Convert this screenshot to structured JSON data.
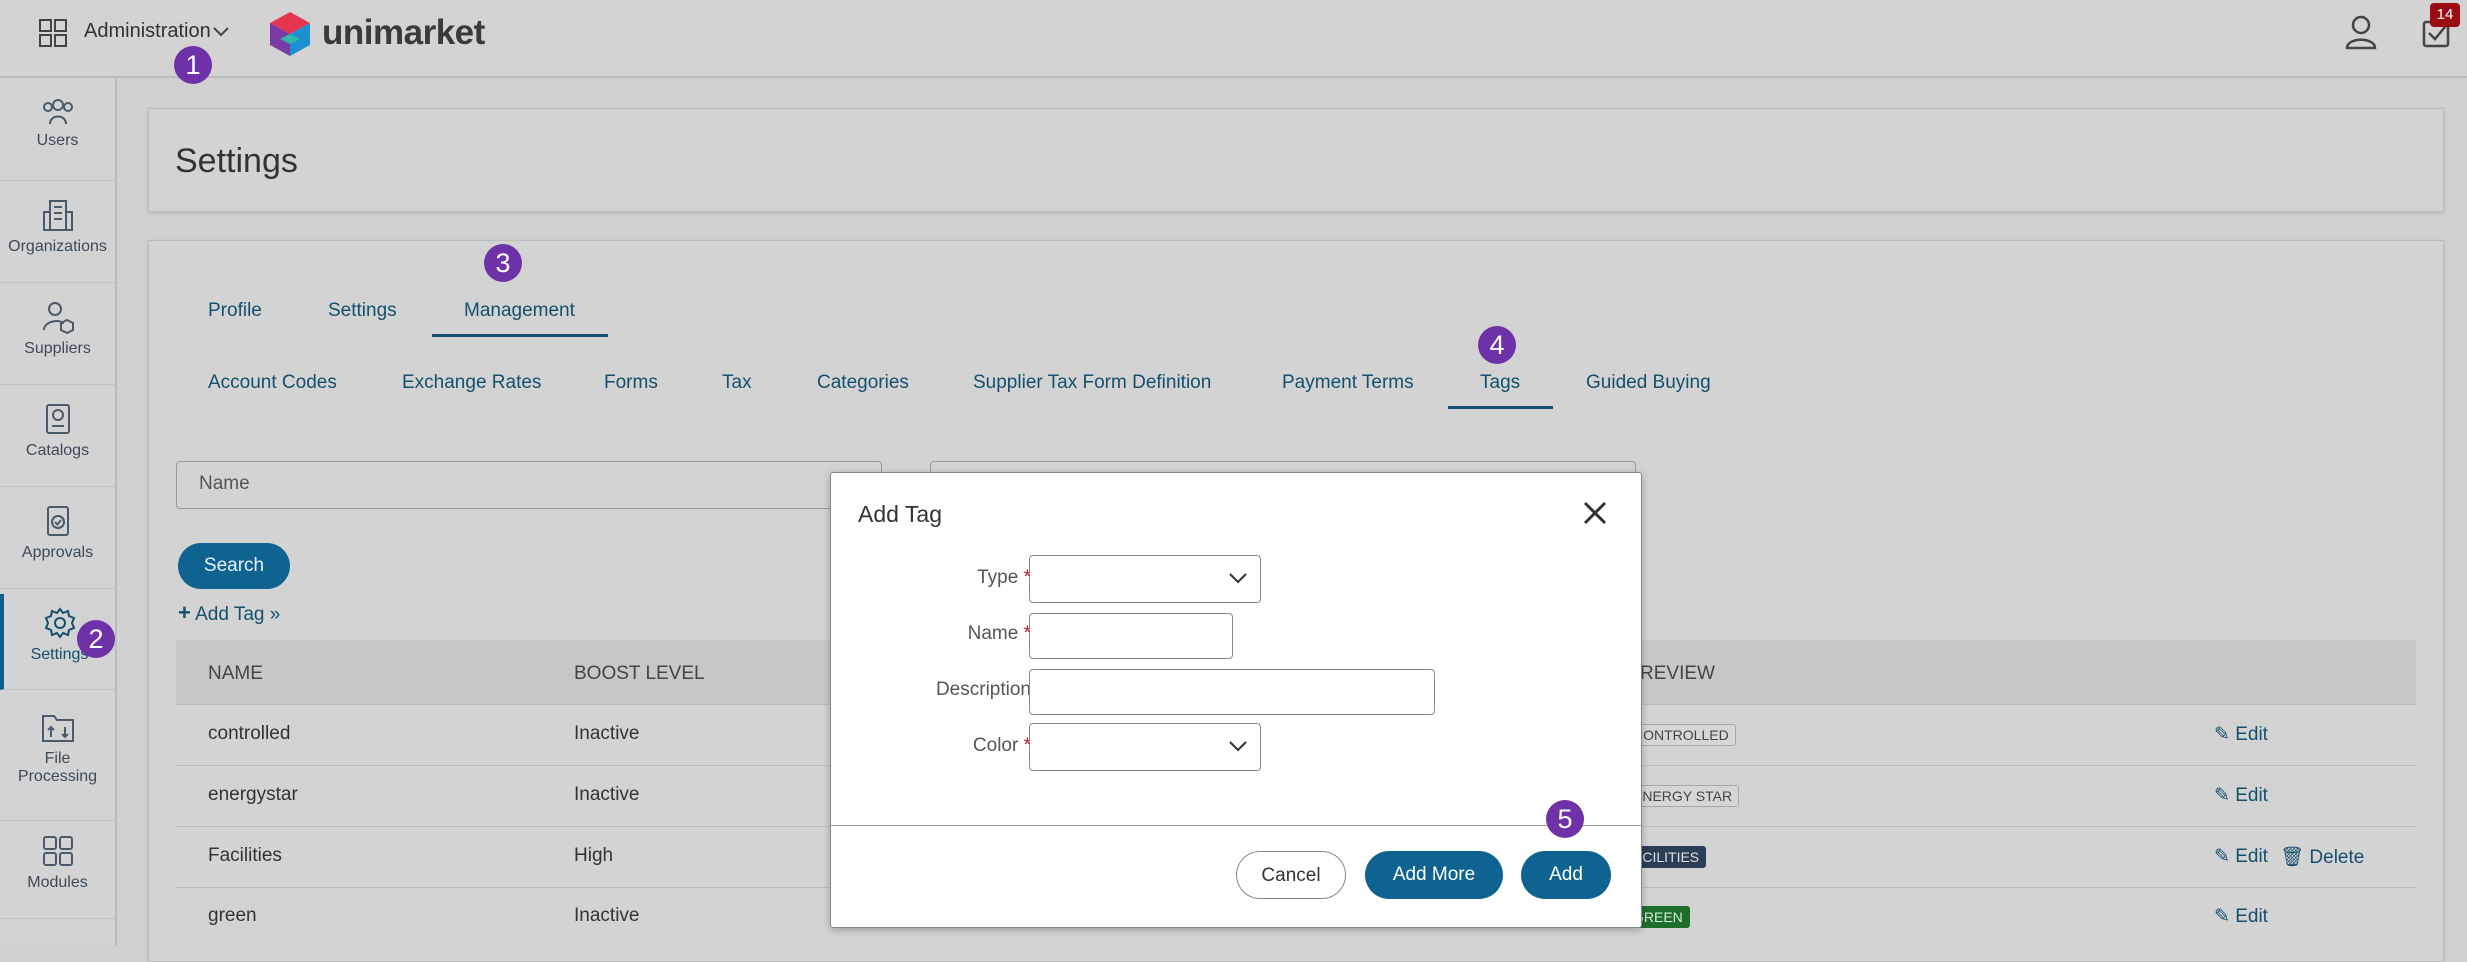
{
  "topbar": {
    "module_label": "Administration",
    "brand": "unimarket",
    "notification_count": "14"
  },
  "callouts": [
    "1",
    "2",
    "3",
    "4",
    "5"
  ],
  "sidebar": {
    "items": [
      {
        "label": "Users",
        "icon": "users-icon"
      },
      {
        "label": "Organizations",
        "icon": "building-icon"
      },
      {
        "label": "Suppliers",
        "icon": "supplier-icon"
      },
      {
        "label": "Catalogs",
        "icon": "catalog-icon"
      },
      {
        "label": "Approvals",
        "icon": "approval-icon"
      },
      {
        "label": "Settings",
        "icon": "gear-icon"
      },
      {
        "label": "File Processing",
        "icon": "file-processing-icon"
      },
      {
        "label": "Modules",
        "icon": "modules-icon"
      }
    ],
    "active": "Settings"
  },
  "page": {
    "title": "Settings",
    "tabs": [
      "Profile",
      "Settings",
      "Management"
    ],
    "active_tab": "Management",
    "subtabs": [
      "Account Codes",
      "Exchange Rates",
      "Forms",
      "Tax",
      "Categories",
      "Supplier Tax Form Definition",
      "Payment Terms",
      "Tags",
      "Guided Buying"
    ],
    "active_subtab": "Tags"
  },
  "filters": {
    "name_placeholder": "Name",
    "search_label": "Search",
    "add_tag_link": "Add Tag »"
  },
  "table": {
    "headers": [
      "NAME",
      "BOOST LEVEL",
      "REVIEW"
    ],
    "rows": [
      {
        "name": "controlled",
        "boost": "Inactive",
        "preview": "CONTROLLED",
        "preview_style": "light",
        "actions": [
          "Edit"
        ]
      },
      {
        "name": "energystar",
        "boost": "Inactive",
        "preview": "ENERGY STAR",
        "preview_style": "light",
        "actions": [
          "Edit"
        ]
      },
      {
        "name": "Facilities",
        "boost": "High",
        "preview": "ACILITIES",
        "preview_style": "dark",
        "actions": [
          "Edit",
          "Delete"
        ]
      },
      {
        "name": "green",
        "boost": "Inactive",
        "preview": "GREEN",
        "preview_style": "green",
        "actions": [
          "Edit"
        ]
      }
    ]
  },
  "modal": {
    "title": "Add Tag",
    "fields": {
      "type": {
        "label": "Type",
        "required": true,
        "value": ""
      },
      "name": {
        "label": "Name",
        "required": true,
        "value": ""
      },
      "description": {
        "label": "Description",
        "required": false,
        "value": ""
      },
      "color": {
        "label": "Color",
        "required": true,
        "value": ""
      }
    },
    "buttons": {
      "cancel": "Cancel",
      "add_more": "Add More",
      "add": "Add"
    }
  },
  "colors": {
    "primary": "#0f6390",
    "callout": "#6e31a8",
    "required": "#c0162d",
    "badge": "#9b0c12"
  }
}
